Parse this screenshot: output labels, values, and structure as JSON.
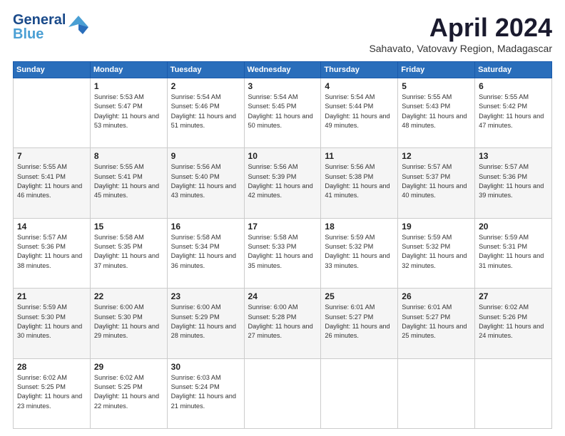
{
  "header": {
    "logo_line1": "General",
    "logo_line2": "Blue",
    "month": "April 2024",
    "location": "Sahavato, Vatovavy Region, Madagascar"
  },
  "weekdays": [
    "Sunday",
    "Monday",
    "Tuesday",
    "Wednesday",
    "Thursday",
    "Friday",
    "Saturday"
  ],
  "weeks": [
    [
      {
        "day": "",
        "info": ""
      },
      {
        "day": "1",
        "info": "Sunrise: 5:53 AM\nSunset: 5:47 PM\nDaylight: 11 hours\nand 53 minutes."
      },
      {
        "day": "2",
        "info": "Sunrise: 5:54 AM\nSunset: 5:46 PM\nDaylight: 11 hours\nand 51 minutes."
      },
      {
        "day": "3",
        "info": "Sunrise: 5:54 AM\nSunset: 5:45 PM\nDaylight: 11 hours\nand 50 minutes."
      },
      {
        "day": "4",
        "info": "Sunrise: 5:54 AM\nSunset: 5:44 PM\nDaylight: 11 hours\nand 49 minutes."
      },
      {
        "day": "5",
        "info": "Sunrise: 5:55 AM\nSunset: 5:43 PM\nDaylight: 11 hours\nand 48 minutes."
      },
      {
        "day": "6",
        "info": "Sunrise: 5:55 AM\nSunset: 5:42 PM\nDaylight: 11 hours\nand 47 minutes."
      }
    ],
    [
      {
        "day": "7",
        "info": "Sunrise: 5:55 AM\nSunset: 5:41 PM\nDaylight: 11 hours\nand 46 minutes."
      },
      {
        "day": "8",
        "info": "Sunrise: 5:55 AM\nSunset: 5:41 PM\nDaylight: 11 hours\nand 45 minutes."
      },
      {
        "day": "9",
        "info": "Sunrise: 5:56 AM\nSunset: 5:40 PM\nDaylight: 11 hours\nand 43 minutes."
      },
      {
        "day": "10",
        "info": "Sunrise: 5:56 AM\nSunset: 5:39 PM\nDaylight: 11 hours\nand 42 minutes."
      },
      {
        "day": "11",
        "info": "Sunrise: 5:56 AM\nSunset: 5:38 PM\nDaylight: 11 hours\nand 41 minutes."
      },
      {
        "day": "12",
        "info": "Sunrise: 5:57 AM\nSunset: 5:37 PM\nDaylight: 11 hours\nand 40 minutes."
      },
      {
        "day": "13",
        "info": "Sunrise: 5:57 AM\nSunset: 5:36 PM\nDaylight: 11 hours\nand 39 minutes."
      }
    ],
    [
      {
        "day": "14",
        "info": "Sunrise: 5:57 AM\nSunset: 5:36 PM\nDaylight: 11 hours\nand 38 minutes."
      },
      {
        "day": "15",
        "info": "Sunrise: 5:58 AM\nSunset: 5:35 PM\nDaylight: 11 hours\nand 37 minutes."
      },
      {
        "day": "16",
        "info": "Sunrise: 5:58 AM\nSunset: 5:34 PM\nDaylight: 11 hours\nand 36 minutes."
      },
      {
        "day": "17",
        "info": "Sunrise: 5:58 AM\nSunset: 5:33 PM\nDaylight: 11 hours\nand 35 minutes."
      },
      {
        "day": "18",
        "info": "Sunrise: 5:59 AM\nSunset: 5:32 PM\nDaylight: 11 hours\nand 33 minutes."
      },
      {
        "day": "19",
        "info": "Sunrise: 5:59 AM\nSunset: 5:32 PM\nDaylight: 11 hours\nand 32 minutes."
      },
      {
        "day": "20",
        "info": "Sunrise: 5:59 AM\nSunset: 5:31 PM\nDaylight: 11 hours\nand 31 minutes."
      }
    ],
    [
      {
        "day": "21",
        "info": "Sunrise: 5:59 AM\nSunset: 5:30 PM\nDaylight: 11 hours\nand 30 minutes."
      },
      {
        "day": "22",
        "info": "Sunrise: 6:00 AM\nSunset: 5:30 PM\nDaylight: 11 hours\nand 29 minutes."
      },
      {
        "day": "23",
        "info": "Sunrise: 6:00 AM\nSunset: 5:29 PM\nDaylight: 11 hours\nand 28 minutes."
      },
      {
        "day": "24",
        "info": "Sunrise: 6:00 AM\nSunset: 5:28 PM\nDaylight: 11 hours\nand 27 minutes."
      },
      {
        "day": "25",
        "info": "Sunrise: 6:01 AM\nSunset: 5:27 PM\nDaylight: 11 hours\nand 26 minutes."
      },
      {
        "day": "26",
        "info": "Sunrise: 6:01 AM\nSunset: 5:27 PM\nDaylight: 11 hours\nand 25 minutes."
      },
      {
        "day": "27",
        "info": "Sunrise: 6:02 AM\nSunset: 5:26 PM\nDaylight: 11 hours\nand 24 minutes."
      }
    ],
    [
      {
        "day": "28",
        "info": "Sunrise: 6:02 AM\nSunset: 5:25 PM\nDaylight: 11 hours\nand 23 minutes."
      },
      {
        "day": "29",
        "info": "Sunrise: 6:02 AM\nSunset: 5:25 PM\nDaylight: 11 hours\nand 22 minutes."
      },
      {
        "day": "30",
        "info": "Sunrise: 6:03 AM\nSunset: 5:24 PM\nDaylight: 11 hours\nand 21 minutes."
      },
      {
        "day": "",
        "info": ""
      },
      {
        "day": "",
        "info": ""
      },
      {
        "day": "",
        "info": ""
      },
      {
        "day": "",
        "info": ""
      }
    ]
  ]
}
